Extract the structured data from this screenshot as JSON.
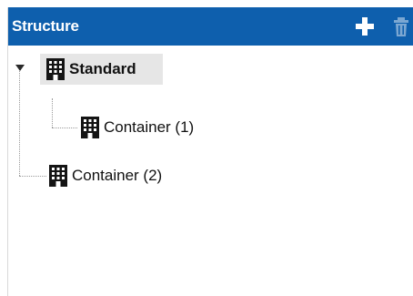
{
  "header": {
    "title": "Structure",
    "add_icon": "plus-icon",
    "delete_icon": "trash-icon",
    "background": "#0e5fad"
  },
  "tree": {
    "nodes": [
      {
        "label": "Standard",
        "icon": "building-icon",
        "selected": true,
        "expanded": true,
        "bold": true
      },
      {
        "label": "Container (1)",
        "icon": "building-icon",
        "selected": false
      },
      {
        "label": "Container (2)",
        "icon": "building-icon",
        "selected": false
      }
    ]
  }
}
